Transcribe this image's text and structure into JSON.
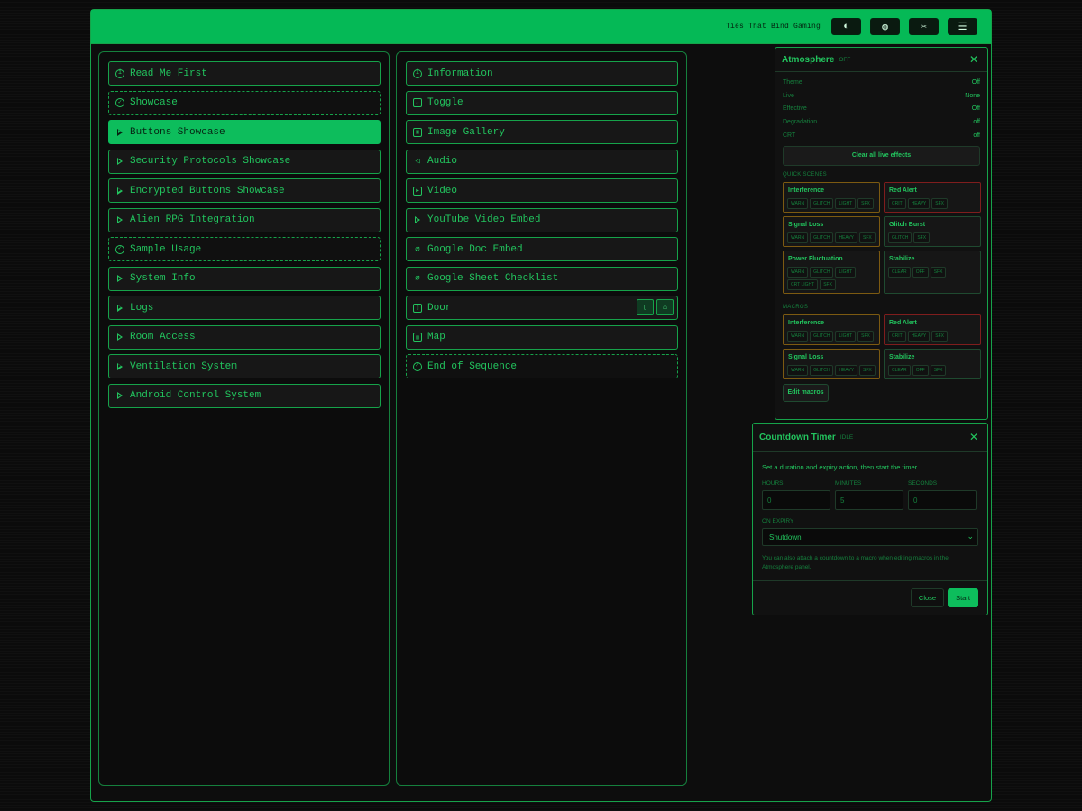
{
  "brand": "Ties That Bind Gaming",
  "colors": {
    "accent": "#0dbd5c",
    "text": "#22c55e",
    "background": "#0b0b0b",
    "warn": "#7c5a11",
    "alert": "#7f1d1d"
  },
  "toolbar": [
    {
      "icon": "half-circle-icon"
    },
    {
      "icon": "globe-icon"
    },
    {
      "icon": "tools-icon"
    },
    {
      "icon": "hamburger-menu-icon"
    }
  ],
  "left_items": [
    {
      "label": "Read Me First",
      "icon": "info-circle-icon",
      "style": "normal"
    },
    {
      "label": "Showcase",
      "icon": "check-circle-icon",
      "style": "dashed"
    },
    {
      "label": "Buttons Showcase",
      "icon": "triangle-right-icon",
      "style": "active"
    },
    {
      "label": "Security Protocols Showcase",
      "icon": "triangle-right-icon",
      "style": "normal"
    },
    {
      "label": "Encrypted Buttons Showcase",
      "icon": "triangle-right-icon",
      "style": "normal"
    },
    {
      "label": "Alien RPG Integration",
      "icon": "triangle-right-icon",
      "style": "normal"
    },
    {
      "label": "Sample Usage",
      "icon": "check-circle-icon",
      "style": "dashed"
    },
    {
      "label": "System Info",
      "icon": "triangle-right-icon",
      "style": "normal"
    },
    {
      "label": "Logs",
      "icon": "triangle-right-icon",
      "style": "normal"
    },
    {
      "label": "Room Access",
      "icon": "triangle-right-icon",
      "style": "normal"
    },
    {
      "label": "Ventilation System",
      "icon": "triangle-right-icon",
      "style": "normal"
    },
    {
      "label": "Android Control System",
      "icon": "triangle-right-icon",
      "style": "normal"
    }
  ],
  "right_items": [
    {
      "label": "Information",
      "icon": "info-circle-icon",
      "style": "normal"
    },
    {
      "label": "Toggle",
      "icon": "toggle-icon",
      "style": "normal"
    },
    {
      "label": "Image Gallery",
      "icon": "image-icon",
      "style": "normal"
    },
    {
      "label": "Audio",
      "icon": "speaker-icon",
      "style": "normal"
    },
    {
      "label": "Video",
      "icon": "video-icon",
      "style": "normal"
    },
    {
      "label": "YouTube Video Embed",
      "icon": "triangle-right-icon",
      "style": "normal"
    },
    {
      "label": "Google Doc Embed",
      "icon": "paperclip-icon",
      "style": "normal"
    },
    {
      "label": "Google Sheet Checklist",
      "icon": "paperclip-icon",
      "style": "normal"
    },
    {
      "label": "Door",
      "icon": "door-icon",
      "style": "normal",
      "door": true
    },
    {
      "label": "Map",
      "icon": "map-icon",
      "style": "normal"
    },
    {
      "label": "End of Sequence",
      "icon": "check-circle-icon",
      "style": "dashed"
    }
  ],
  "atmosphere": {
    "title": "Atmosphere",
    "status": "OFF",
    "settings": [
      {
        "key": "Theme",
        "value": "Off"
      },
      {
        "key": "Live",
        "value": "None"
      },
      {
        "key": "Effective",
        "value": "Off"
      },
      {
        "key": "Degradation",
        "value": "off"
      },
      {
        "key": "CRT",
        "value": "off"
      }
    ],
    "clear_label": "Clear all live effects",
    "quick_label": "QUICK SCENES",
    "quick_scenes": [
      {
        "name": "Interference",
        "tone": "warn",
        "tags": [
          "WARN",
          "GLITCH",
          "LIGHT",
          "SFX"
        ]
      },
      {
        "name": "Red Alert",
        "tone": "red",
        "tags": [
          "CRIT",
          "HEAVY",
          "SFX"
        ]
      },
      {
        "name": "Signal Loss",
        "tone": "warn",
        "tags": [
          "WARN",
          "GLITCH",
          "HEAVY",
          "SFX"
        ]
      },
      {
        "name": "Glitch Burst",
        "tone": "ok",
        "tags": [
          "GLITCH",
          "SFX"
        ]
      },
      {
        "name": "Power Fluctuation",
        "tone": "warn",
        "tags": [
          "WARN",
          "GLITCH",
          "LIGHT",
          "CRT LIGHT",
          "SFX"
        ]
      },
      {
        "name": "Stabilize",
        "tone": "ok",
        "tags": [
          "CLEAR",
          "OFF",
          "SFX"
        ]
      }
    ],
    "macros_label": "MACROS",
    "macros": [
      {
        "name": "Interference",
        "tone": "warn",
        "tags": [
          "WARN",
          "GLITCH",
          "LIGHT",
          "SFX"
        ]
      },
      {
        "name": "Red Alert",
        "tone": "red",
        "tags": [
          "CRIT",
          "HEAVY",
          "SFX"
        ]
      },
      {
        "name": "Signal Loss",
        "tone": "warn",
        "tags": [
          "WARN",
          "GLITCH",
          "HEAVY",
          "SFX"
        ]
      },
      {
        "name": "Stabilize",
        "tone": "ok",
        "tags": [
          "CLEAR",
          "OFF",
          "SFX"
        ]
      }
    ],
    "edit_label": "Edit macros"
  },
  "countdown": {
    "title": "Countdown Timer",
    "status": "IDLE",
    "description": "Set a duration and expiry action, then start the timer.",
    "hours_label": "HOURS",
    "hours_value": "0",
    "minutes_label": "MINUTES",
    "minutes_value": "5",
    "seconds_label": "SECONDS",
    "seconds_value": "0",
    "expiry_label": "ON EXPIRY",
    "expiry_value": "Shutdown",
    "note": "You can also attach a countdown to a macro when editing macros in the Atmosphere panel.",
    "close_label": "Close",
    "start_label": "Start"
  }
}
